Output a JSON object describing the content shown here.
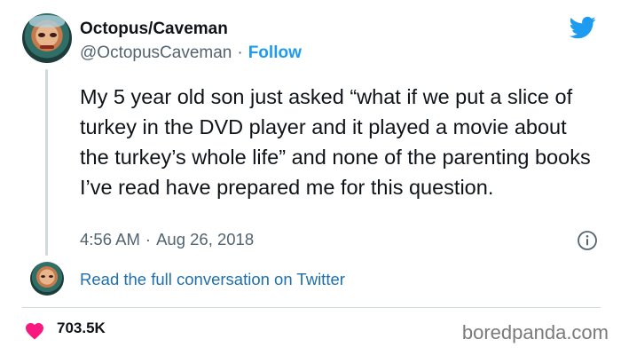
{
  "tweet": {
    "author_name": "Octopus/Caveman",
    "handle": "@OctopusCaveman",
    "separator": "·",
    "follow_label": "Follow",
    "text": "My 5 year old son just asked “what if we put a slice of turkey in the DVD player and it played a movie about the turkey’s whole life” and none of the parenting books I’ve read have prepared me for this question.",
    "time": "4:56 AM",
    "date": "Aug 26, 2018",
    "read_conversation": "Read the full conversation on Twitter",
    "likes": "703.5K"
  },
  "icons": {
    "brand": "twitter-bird-icon",
    "info": "info-icon",
    "like": "heart-icon"
  },
  "watermark": "boredpanda.com",
  "colors": {
    "brand_blue": "#1d9bf0",
    "link_blue": "#1d6fb0",
    "heart_red": "#f91880",
    "secondary_text": "#536471",
    "divider": "#cfd9de"
  }
}
